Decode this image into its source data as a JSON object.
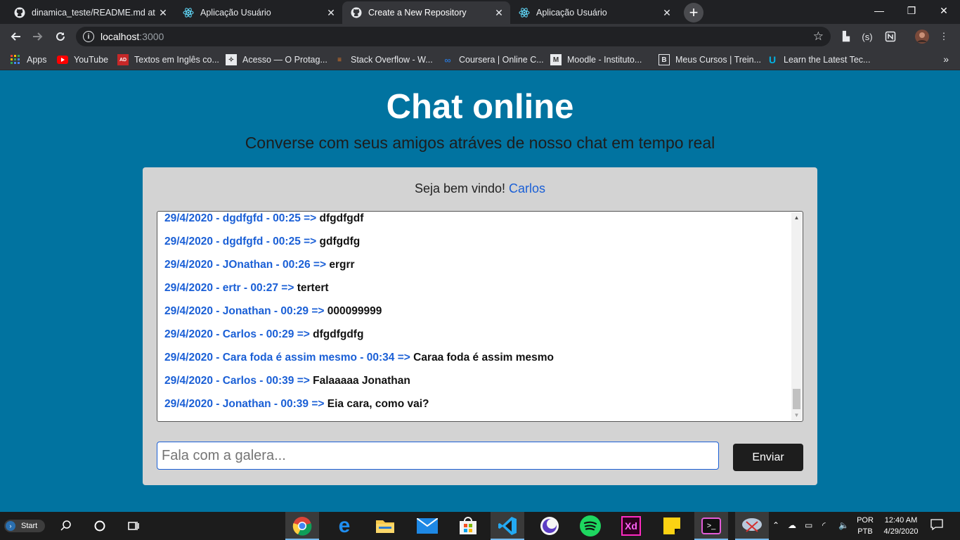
{
  "browser": {
    "tabs": [
      {
        "title": "dinamica_teste/README.md at m",
        "favicon": "github-icon",
        "active": false
      },
      {
        "title": "Aplicação Usuário",
        "favicon": "react-icon",
        "active": false
      },
      {
        "title": "Create a New Repository",
        "favicon": "github-icon",
        "active": true
      },
      {
        "title": "Aplicação Usuário",
        "favicon": "react-icon",
        "active": false
      }
    ],
    "url_host": "localhost",
    "url_port": ":3000",
    "bookmarks": [
      {
        "label": "Apps",
        "icon": "apps-grid-icon"
      },
      {
        "label": "YouTube",
        "icon": "youtube-icon"
      },
      {
        "label": "Textos em Inglês co...",
        "icon": "textos-icon"
      },
      {
        "label": "Acesso — O Protag...",
        "icon": "acesso-icon"
      },
      {
        "label": "Stack Overflow - W...",
        "icon": "stackoverflow-icon"
      },
      {
        "label": "Coursera | Online C...",
        "icon": "coursera-icon"
      },
      {
        "label": "Moodle - Instituto...",
        "icon": "moodle-icon"
      },
      {
        "label": "Meus Cursos | Trein...",
        "icon": "cursos-icon"
      },
      {
        "label": "Learn the Latest Tec...",
        "icon": "udacity-icon"
      }
    ]
  },
  "page": {
    "title": "Chat online",
    "subtitle": "Converse com seus amigos atráves de nosso chat em tempo real",
    "welcome_prefix": "Seja bem vindo!",
    "username": "Carlos",
    "messages": [
      {
        "meta": "29/4/2020 - dgdfgfd - 00:25 =>",
        "text": "dfgdfgdf"
      },
      {
        "meta": "29/4/2020 - dgdfgfd - 00:25 =>",
        "text": "gdfgdfg"
      },
      {
        "meta": "29/4/2020 - JOnathan - 00:26 =>",
        "text": "ergrr"
      },
      {
        "meta": "29/4/2020 - ertr - 00:27 =>",
        "text": "tertert"
      },
      {
        "meta": "29/4/2020 - Jonathan - 00:29 =>",
        "text": "000099999"
      },
      {
        "meta": "29/4/2020 - Carlos - 00:29 =>",
        "text": "dfgdfgdfg"
      },
      {
        "meta": "29/4/2020 - Cara foda é assim mesmo - 00:34 =>",
        "text": "Caraa foda é assim mesmo"
      },
      {
        "meta": "29/4/2020 - Carlos - 00:39 =>",
        "text": "Falaaaaa Jonathan"
      },
      {
        "meta": "29/4/2020 - Jonathan - 00:39 =>",
        "text": "Eia cara, como vai?"
      }
    ],
    "input_placeholder": "Fala com a galera...",
    "input_value": "",
    "send_label": "Enviar"
  },
  "taskbar": {
    "start_label": "Start",
    "lang_top": "POR",
    "lang_bottom": "PTB",
    "time": "12:40 AM",
    "date": "4/29/2020"
  },
  "colors": {
    "page_bg": "#0173a0",
    "card_bg": "#d3d3d3",
    "meta_blue": "#1a5fd6",
    "button_bg": "#1d1d1d"
  }
}
